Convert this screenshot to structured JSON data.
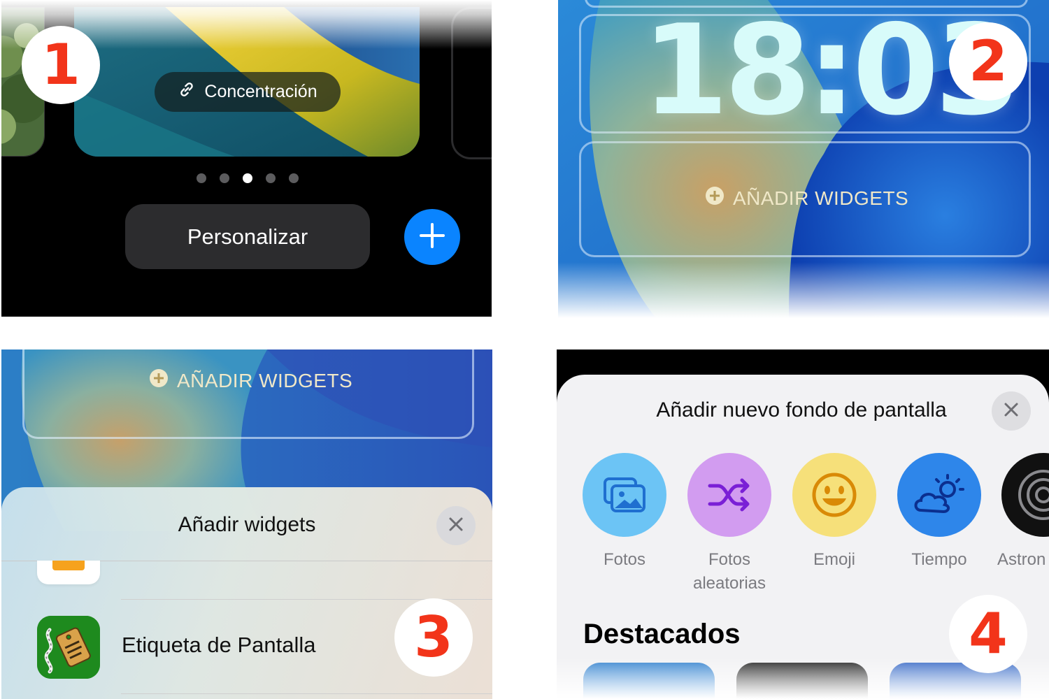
{
  "panel1": {
    "badge": "1",
    "focus_mode": {
      "label": "Concentración",
      "icon": "link-icon"
    },
    "page_dots": {
      "count": 5,
      "active_index": 2
    },
    "customize_button": "Personalizar",
    "add_button_icon": "plus-icon",
    "colors": {
      "accent": "#0a84ff"
    }
  },
  "panel2": {
    "badge": "2",
    "time": "18:03",
    "add_widgets": {
      "label": "AÑADIR WIDGETS",
      "icon": "plus-circle-icon"
    }
  },
  "panel3": {
    "badge": "3",
    "add_widgets": {
      "label": "AÑADIR WIDGETS",
      "icon": "plus-circle-icon"
    },
    "sheet_title": "Añadir widgets",
    "close_icon": "close-icon",
    "apps": [
      {
        "label": "Etiqueta de Pantalla",
        "icon": "price-tag-app-icon"
      }
    ]
  },
  "panel4": {
    "badge": "4",
    "title": "Añadir nuevo fondo de pantalla",
    "close_icon": "close-icon",
    "options": [
      {
        "label": "Fotos",
        "icon": "photos-icon",
        "color": "#6cc4f5"
      },
      {
        "label": "Fotos aleatorias",
        "icon": "shuffle-icon",
        "color": "#d29cf0"
      },
      {
        "label": "Emoji",
        "icon": "smiley-icon",
        "color": "#f6e07a"
      },
      {
        "label": "Tiempo",
        "icon": "weather-icon",
        "color": "#2e86ea"
      },
      {
        "label": "Astron",
        "icon": "astronomy-icon",
        "color": "#111111"
      }
    ],
    "featured_heading": "Destacados"
  }
}
